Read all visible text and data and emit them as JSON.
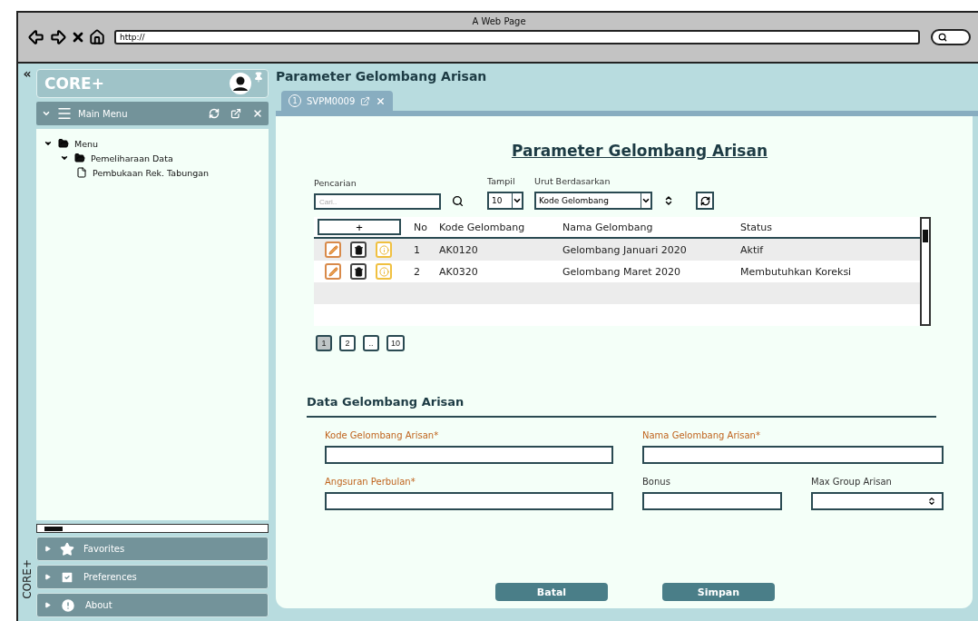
{
  "browser": {
    "title": "A Web Page",
    "address": "http://"
  },
  "sidebar": {
    "collapse": "«",
    "brand": "CORE+",
    "menu_title": "Main Menu",
    "tree": [
      {
        "label": "Menu",
        "expanded": true,
        "children": [
          {
            "label": "Pemeliharaan Data",
            "expanded": true,
            "children": [
              {
                "label": "Pembukaan Rek. Tabungan"
              }
            ]
          }
        ]
      }
    ],
    "panels": [
      {
        "label": "Favorites",
        "kind": "star"
      },
      {
        "label": "Preferences",
        "kind": "check"
      },
      {
        "label": "About",
        "kind": "alert"
      }
    ],
    "vertical_label": "CORE+"
  },
  "page_title": "Parameter Gelombang Arisan",
  "tabs": [
    {
      "number": "1",
      "label": "SVPM0009",
      "selected": true
    }
  ],
  "list": {
    "title": "Parameter Gelombang Arisan",
    "search": {
      "label": "Pencarian",
      "placeholder": "Cari.."
    },
    "show": {
      "label": "Tampil",
      "value": "10"
    },
    "sort": {
      "label": "Urut Berdasarkan",
      "value": "Kode Gelombang"
    },
    "add": "+",
    "columns": [
      "No",
      "Kode Gelombang",
      "Nama Gelombang",
      "Status"
    ],
    "rows": [
      {
        "no": "1",
        "code": "AK0120",
        "name": "Gelombang Januari 2020",
        "status": "Aktif"
      },
      {
        "no": "2",
        "code": "AK0320",
        "name": "Gelombang Maret 2020",
        "status": "Membutuhkan Koreksi"
      }
    ],
    "pages": [
      {
        "label": "1",
        "selected": true
      },
      {
        "label": "2",
        "selected": false
      },
      {
        "label": "..",
        "selected": false
      },
      {
        "label": "10",
        "selected": false
      }
    ]
  },
  "form": {
    "title": "Data Gelombang Arisan",
    "fields": [
      {
        "label": "Kode Gelombang Arisan*",
        "required": true,
        "kind": "text"
      },
      {
        "label": "Nama Gelombang Arisan*",
        "required": true,
        "kind": "text"
      },
      {
        "label": "Angsuran Perbulan*",
        "required": true,
        "kind": "text"
      },
      {
        "label": "Bonus",
        "required": false,
        "kind": "text"
      },
      {
        "label": "Max Group Arisan",
        "required": false,
        "kind": "spinner"
      }
    ],
    "buttons": [
      "Batal",
      "Simpan"
    ]
  }
}
